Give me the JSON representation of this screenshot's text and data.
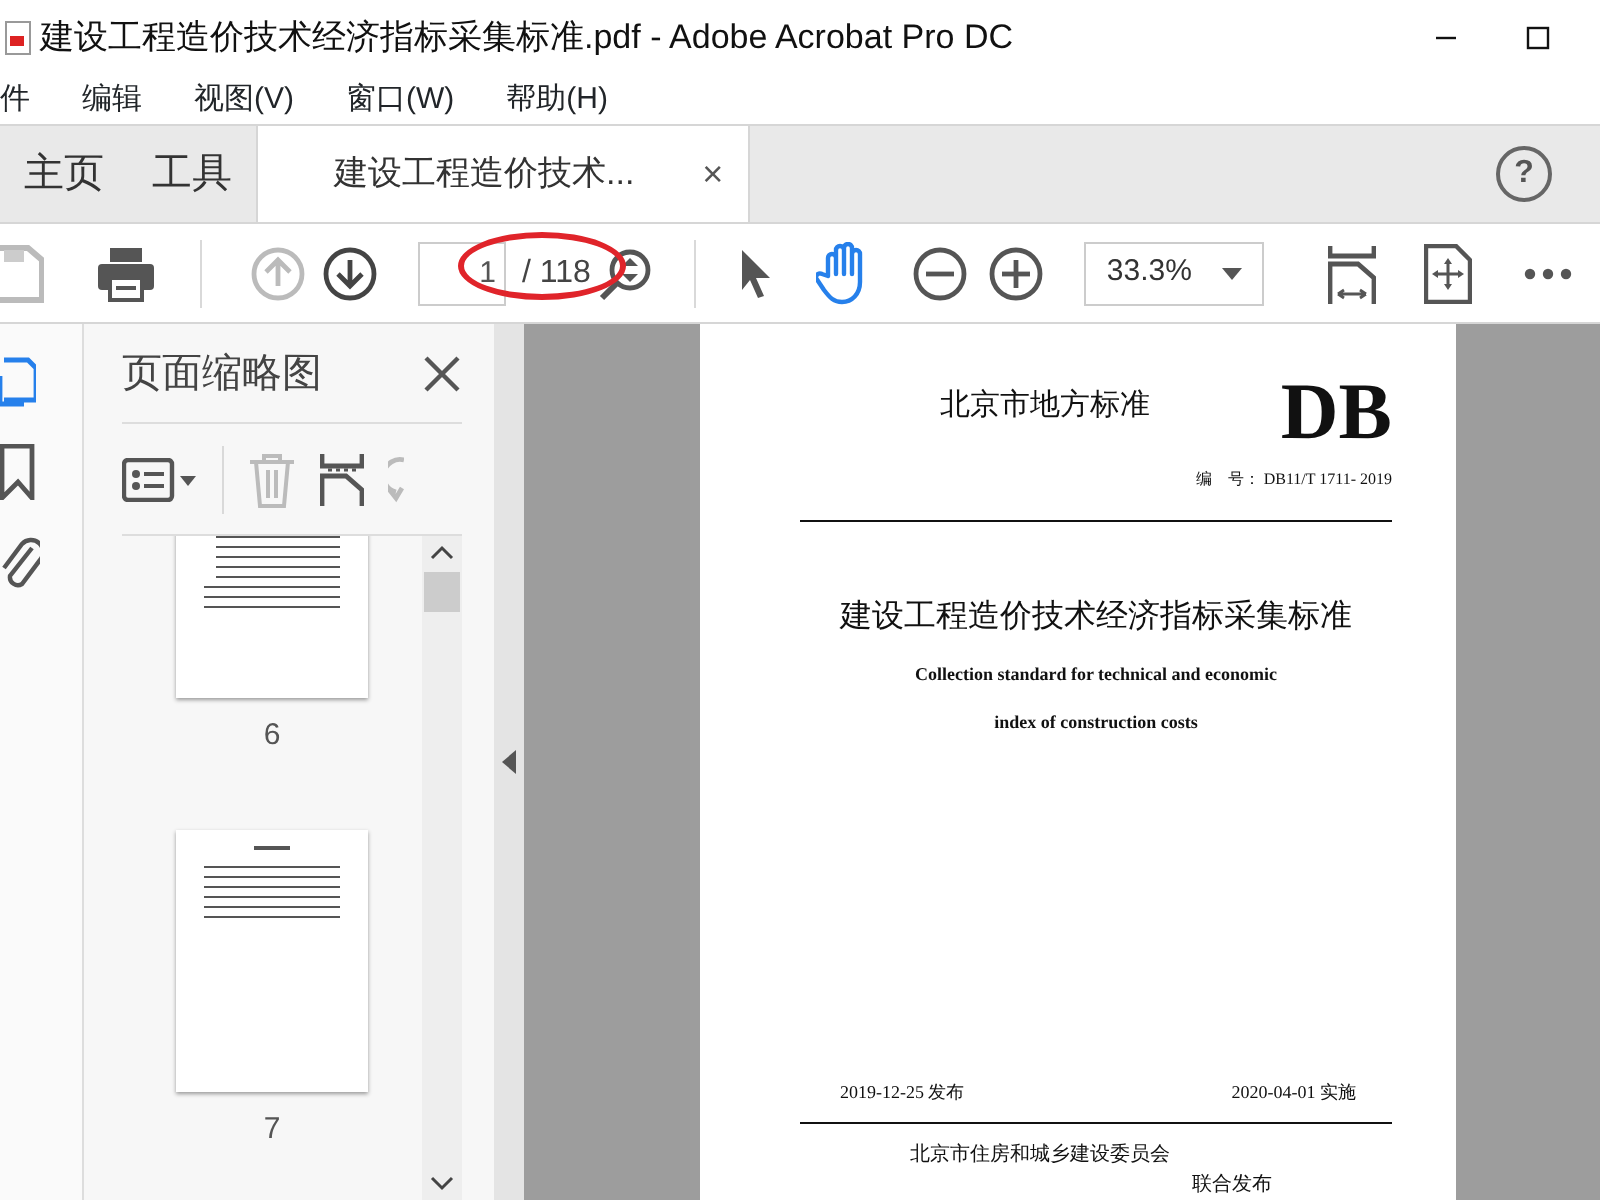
{
  "window": {
    "title": "建设工程造价技术经济指标采集标准.pdf - Adobe Acrobat Pro DC"
  },
  "menu": [
    "件",
    "编辑",
    "视图(V)",
    "窗口(W)",
    "帮助(H)"
  ],
  "tabs": [
    {
      "label": "主页",
      "selected": false
    },
    {
      "label": "工具",
      "selected": false
    },
    {
      "label": "建设工程造价技术...",
      "selected": true,
      "close": "×"
    }
  ],
  "help": "?",
  "toolbar": {
    "nav": [
      {
        "kind": "prev",
        "disabled": true
      },
      {
        "kind": "next",
        "disabled": false
      }
    ],
    "page": {
      "value": "1",
      "total": "/ 118",
      "circled": true
    },
    "tools": [
      {
        "kind": "select",
        "selected": false
      },
      {
        "kind": "hand",
        "selected": true
      }
    ],
    "zoom": "33.3%"
  },
  "sidebar": {
    "rail": [
      {
        "kind": "pages",
        "selected": true
      },
      {
        "kind": "bookmarks",
        "selected": false
      },
      {
        "kind": "attachments",
        "selected": false
      }
    ],
    "panel": {
      "title": "页面缩略图",
      "thumbnails": [
        {
          "label": "6",
          "kind": "contents"
        },
        {
          "label": "7",
          "kind": "text"
        }
      ]
    }
  },
  "document": {
    "authority": "北京市地方标准",
    "mark": "DB",
    "number_label": "编　号：",
    "number": "DB11/T 1711- 2019",
    "title": "建设工程造价技术经济指标采集标准",
    "subtitle": [
      "Collection standard for technical and economic",
      "index of construction costs"
    ],
    "issued": "2019-12-25",
    "issued_label": "发布",
    "effective": "2020-04-01",
    "effective_label": "实施",
    "publisher": "北京市住房和城乡建设委员会",
    "joint": "联合发布"
  }
}
